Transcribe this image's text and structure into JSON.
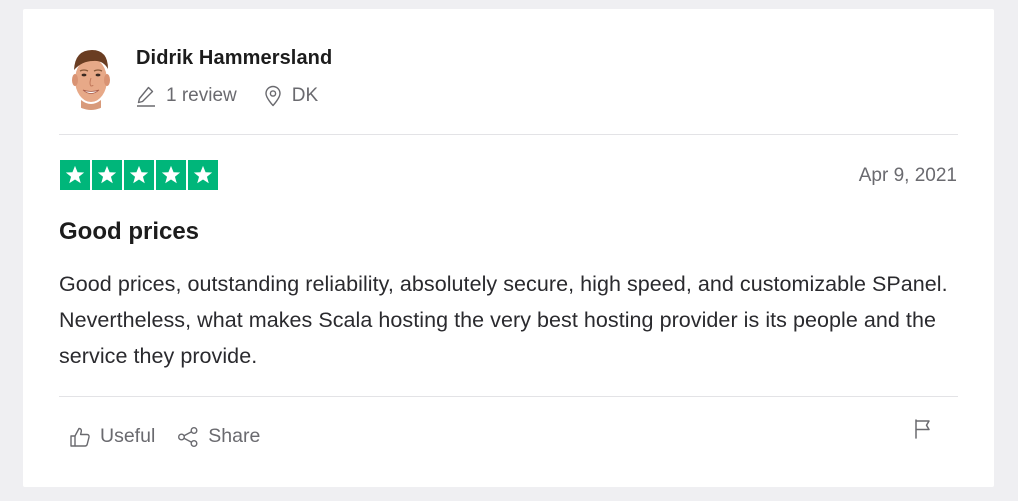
{
  "consumer": {
    "name": "Didrik Hammersland",
    "review_count": "1 review",
    "location": "DK",
    "avatar_icon": "user-avatar-photo"
  },
  "review": {
    "rating_stars": 5,
    "rating_max": 5,
    "rating_color": "#00b67a",
    "date": "Apr 9, 2021",
    "title": "Good prices",
    "text": "Good prices, outstanding reliability, absolutely secure, high speed, and customizable SPanel. Nevertheless, what makes Scala hosting the very best hosting provider is its people and the service they provide."
  },
  "actions": {
    "useful_label": "Useful",
    "share_label": "Share",
    "useful_icon": "thumbs-up-icon",
    "share_icon": "share-icon",
    "flag_icon": "flag-icon"
  }
}
